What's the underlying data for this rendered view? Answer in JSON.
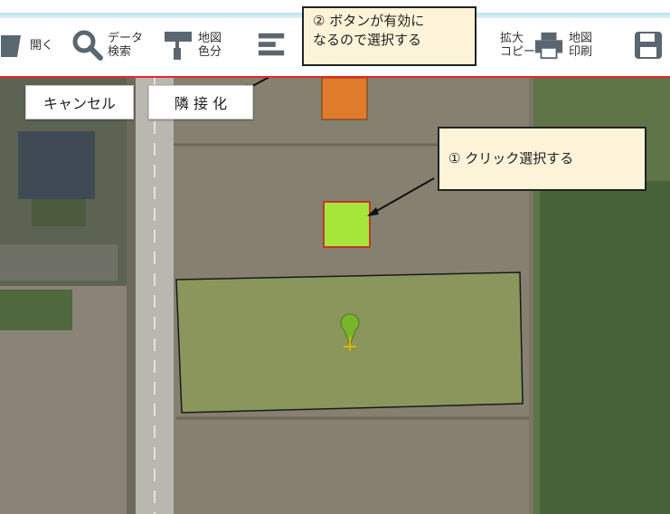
{
  "toolbar": {
    "buttons": [
      {
        "id": "open",
        "label": "開く",
        "icon": "folder-icon"
      },
      {
        "id": "data-search",
        "label": "データ\n検索",
        "icon": "search-icon"
      },
      {
        "id": "map-color",
        "label": "地図\n色分",
        "icon": "paint-roller-icon"
      },
      {
        "id": "layers",
        "label": "",
        "icon": "layers-icon"
      },
      {
        "id": "zoom-copy",
        "label": "拡大\nコピー",
        "icon": "copy-icon"
      },
      {
        "id": "map-print",
        "label": "地図\n印刷",
        "icon": "printer-icon"
      },
      {
        "id": "save",
        "label": "",
        "icon": "save-icon"
      }
    ]
  },
  "map_buttons": {
    "cancel_label": "キャンセル",
    "adjacent_label": "隣 接 化"
  },
  "callouts": {
    "step2": "② ボタンが有効に\nなるので選択する",
    "step1": "① クリック選択する"
  },
  "colors": {
    "toolbar_red_line": "#e8272b",
    "selected_parcel": "#a6e63a",
    "orange_parcel": "#e07b2b",
    "large_parcel_fill": "#8b9a58",
    "callout_bg": "#fdf3d8"
  }
}
